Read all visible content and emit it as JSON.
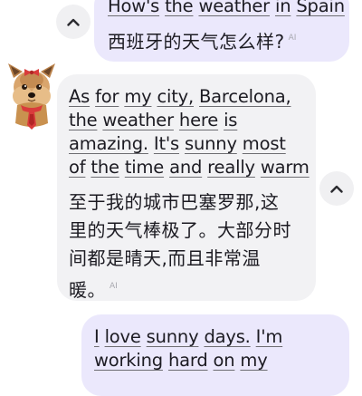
{
  "chat": {
    "messages": [
      {
        "role": "user",
        "english_words": [
          "How's",
          "the",
          "weather",
          "in",
          "Spain"
        ],
        "translation": "西班牙的天气怎么样?",
        "ai_tag": "AI"
      },
      {
        "role": "bot",
        "english_lines": [
          [
            "As",
            "for",
            "my",
            "city,",
            "Barcelona,"
          ],
          [
            "the",
            "weather",
            "here",
            "is"
          ],
          [
            "amazing.",
            "It's",
            "sunny",
            "most"
          ],
          [
            "of",
            "the",
            "time",
            "and",
            "really",
            "warm"
          ]
        ],
        "translation_lines": [
          "至于我的城市巴塞罗那,这",
          "里的天气棒极了。大部分时",
          "间都是晴天,而且非常温",
          "暖。"
        ],
        "ai_tag": "AI"
      },
      {
        "role": "user",
        "english_lines": [
          [
            "I",
            "love",
            "sunny",
            "days.",
            "I'm"
          ],
          [
            "working",
            "hard",
            "on",
            "my"
          ]
        ]
      }
    ]
  },
  "icons": {
    "collapse": "chevron-up-icon",
    "avatar": "yorkshire-terrier-avatar"
  },
  "colors": {
    "user_bubble": "#ebe8fc",
    "bot_bubble": "#f2f2f4",
    "text": "#1c1b22",
    "underline": "#6d6d72",
    "ai_tag": "#a9a9b0"
  }
}
